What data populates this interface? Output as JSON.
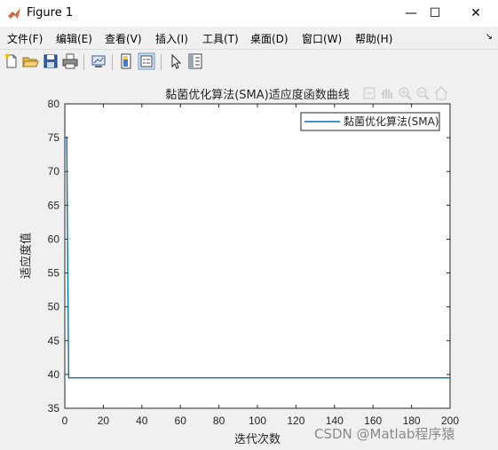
{
  "window": {
    "title": "Figure 1",
    "minimize_symbol": "—",
    "maximize_symbol": "☐",
    "close_symbol": "✕"
  },
  "menu": {
    "items": [
      "文件(F)",
      "编辑(E)",
      "查看(V)",
      "插入(I)",
      "工具(T)",
      "桌面(D)",
      "窗口(W)",
      "帮助(H)"
    ],
    "overflow_symbol": "↘"
  },
  "toolbar": {
    "icons": [
      "new-figure-icon",
      "open-file-icon",
      "save-icon",
      "print-icon",
      "link-plot-icon",
      "insert-colorbar-icon",
      "insert-legend-icon",
      "pointer-icon",
      "property-inspector-icon"
    ]
  },
  "axes_toolbar": {
    "icons": [
      "brush-icon",
      "pan-icon",
      "zoom-in-icon",
      "zoom-out-icon",
      "home-icon"
    ]
  },
  "colors": {
    "line": "#0072bd",
    "axes_bg": "#ffffff",
    "figure_bg": "#f0f0f0"
  },
  "chart_data": {
    "type": "line",
    "title": "黏菌优化算法(SMA)适应度函数曲线",
    "xlabel": "迭代次数",
    "ylabel": "适应度值",
    "xlim": [
      0,
      200
    ],
    "ylim": [
      35,
      80
    ],
    "xticks": [
      0,
      20,
      40,
      60,
      80,
      100,
      120,
      140,
      160,
      180,
      200
    ],
    "yticks": [
      35,
      40,
      45,
      50,
      55,
      60,
      65,
      70,
      75,
      80
    ],
    "legend_position": "top-right",
    "series": [
      {
        "name": "黏菌优化算法(SMA)",
        "x": [
          1,
          2,
          3,
          200
        ],
        "y": [
          75.2,
          39.5,
          39.5,
          39.5
        ]
      }
    ]
  },
  "watermark": "CSDN @Matlab程序猿"
}
